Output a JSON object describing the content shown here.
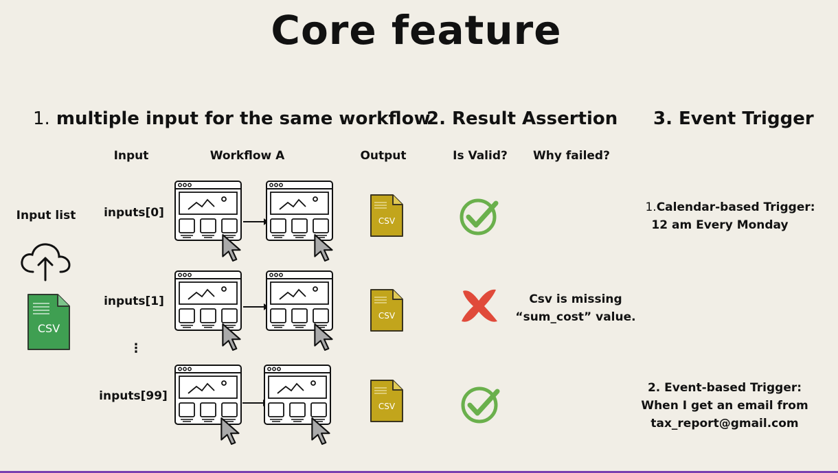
{
  "title": "Core feature",
  "sections": {
    "s1": {
      "num": "1.",
      "label": "multiple input for the same workflow"
    },
    "s2": {
      "label": "2. Result Assertion"
    },
    "s3": {
      "label": "3. Event Trigger"
    }
  },
  "headers": {
    "input": "Input",
    "workflow": "Workflow A",
    "output": "Output",
    "is_valid": "Is Valid?",
    "why_failed": "Why failed?"
  },
  "input_list": {
    "label": "Input list",
    "file_label": "CSV"
  },
  "rows": [
    {
      "input": "inputs[0]",
      "file_label": "CSV",
      "valid": true,
      "reason_1": "",
      "reason_2": ""
    },
    {
      "input": "inputs[1]",
      "file_label": "CSV",
      "valid": false,
      "reason_1": "Csv is missing",
      "reason_2": "“sum_cost” value."
    },
    {
      "input": "inputs[99]",
      "file_label": "CSV",
      "valid": true,
      "reason_1": "",
      "reason_2": ""
    }
  ],
  "ellipsis": "⋮",
  "triggers": {
    "t1": {
      "num": "1.",
      "line1": "Calendar-based Trigger:",
      "line2": "12 am Every Monday"
    },
    "t2": {
      "line1": "2. Event-based Trigger:",
      "line2": "When I get an email from",
      "line3": "tax_report@gmail.com"
    }
  },
  "colors": {
    "background": "#f1eee6",
    "csv_green": "#3f9f52",
    "csv_gold": "#c2a51c",
    "check_green": "#6ab04c",
    "cross_red": "#e04a3a",
    "bottom_border": "#7a3fb0"
  }
}
